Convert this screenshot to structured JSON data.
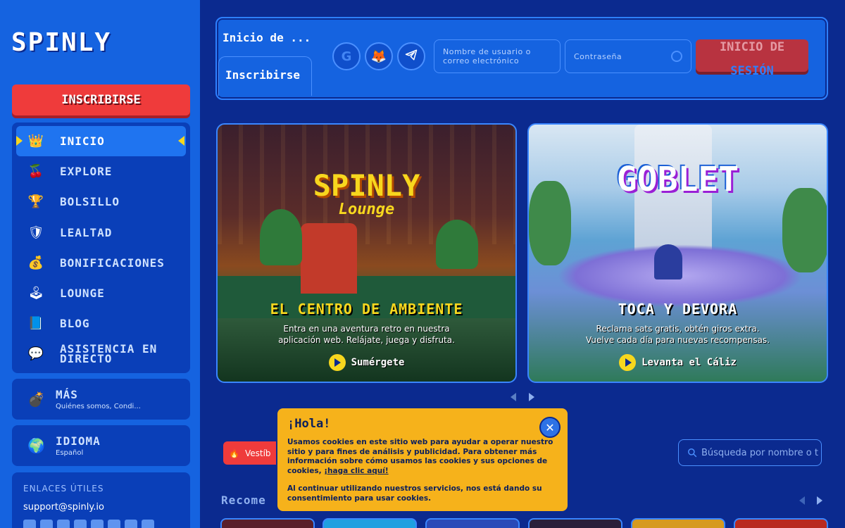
{
  "brand": {
    "logo_text": "SPINLY"
  },
  "sidebar": {
    "signup_label": "INSCRIBIRSE",
    "nav": [
      {
        "label": "INICIO",
        "icon": "crown-icon",
        "active": true
      },
      {
        "label": "EXPLORE",
        "icon": "cherry-icon"
      },
      {
        "label": "BOLSILLO",
        "icon": "trophy-icon"
      },
      {
        "label": "LEALTAD",
        "icon": "shield-icon"
      },
      {
        "label": "BONIFICACIONES",
        "icon": "money-bag-icon"
      },
      {
        "label": "LOUNGE",
        "icon": "joystick-icon"
      },
      {
        "label": "BLOG",
        "icon": "book-icon"
      },
      {
        "label": "ASISTENCIA EN DIRECTO",
        "icon": "chat-heart-icon"
      }
    ],
    "more": {
      "title": "MÁS",
      "subtitle": "Quiénes somos, Condi..."
    },
    "language": {
      "title": "IDIOMA",
      "subtitle": "Español"
    },
    "links": {
      "title": "ENLACES ÚTILES",
      "email": "support@spinly.io"
    }
  },
  "login": {
    "tab_login": "Inicio de ...",
    "tab_signup": "Inscribirse",
    "social": [
      "google-icon",
      "metamask-icon",
      "telegram-icon"
    ],
    "username_placeholder": "Nombre de usuario o correo electrónico",
    "password_placeholder": "Contraseña",
    "submit_line1": "INICIO DE",
    "submit_line2": "SESIÓN"
  },
  "banners": [
    {
      "logo": "SPINLY",
      "logo_sub": "Lounge",
      "title": "EL CENTRO DE AMBIENTE",
      "text_line1": "Entra en una aventura retro en nuestra",
      "text_line2": "aplicación web. Relájate, juega y disfruta.",
      "cta": "Sumérgete"
    },
    {
      "logo": "GOBLET",
      "title": "TOCA Y DEVORA",
      "text_line1": "Reclama sats gratis, obtén giros extra.",
      "text_line2": "Vuelve cada día para nuevas recompensas.",
      "cta": "Levanta el Cáliz"
    }
  ],
  "games": {
    "category_pill": "Vestíb",
    "search_placeholder": "Búsqueda por nombre o t",
    "recommended": "Recome"
  },
  "cookie": {
    "title": "¡Hola!",
    "p1": "Usamos cookies en este sitio web para ayudar a operar nuestro sitio y para fines de análisis y publicidad. Para obtener más información sobre cómo usamos las cookies y sus opciones de cookies,",
    "link": "¡haga clic aquí!",
    "p2": "Al continuar utilizando nuestros servicios, nos está dando su consentimiento para usar cookies."
  },
  "colors": {
    "background": "#0b2a8f",
    "sidebar": "#1563e0",
    "accent_red": "#ef3b3b",
    "accent_yellow": "#f7d71e",
    "cookie_bg": "#f6b21b"
  }
}
